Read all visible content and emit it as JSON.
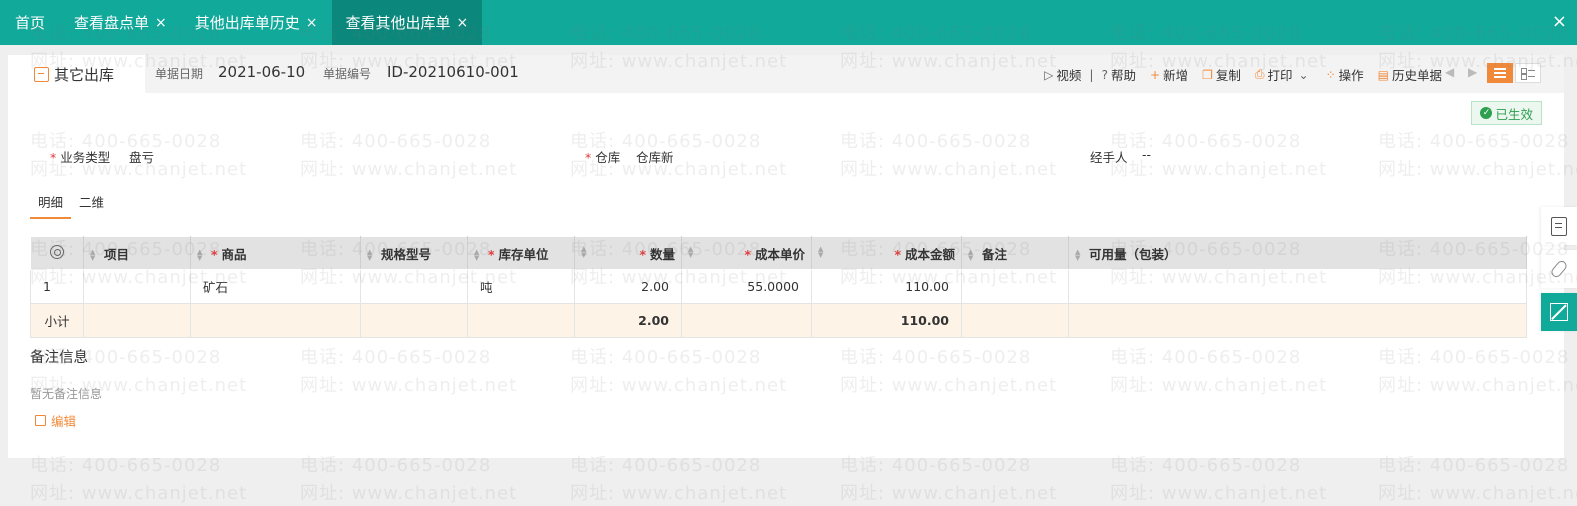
{
  "tabs": [
    {
      "label": "首页",
      "closable": false,
      "active": false
    },
    {
      "label": "查看盘点单",
      "closable": true,
      "active": false
    },
    {
      "label": "其他出库单历史",
      "closable": true,
      "active": false
    },
    {
      "label": "查看其他出库单",
      "closable": true,
      "active": true
    }
  ],
  "tab_close_glyph": "×",
  "window_close_glyph": "×",
  "doc": {
    "type_label": "其它出库",
    "date_label": "单据日期",
    "date_value": "2021-06-10",
    "number_label": "单据编号",
    "number_value": "ID-20210610-001"
  },
  "toolbar": {
    "video": "视频",
    "divider": "|",
    "help": "帮助",
    "add": "新增",
    "copy": "复制",
    "print": "打印",
    "operate": "操作",
    "history": "历史单据"
  },
  "status": {
    "label": "已生效",
    "color": "#2e9e4f"
  },
  "fields": {
    "biz_type_label": "业务类型",
    "biz_type_value": "盘亏",
    "warehouse_label": "仓库",
    "warehouse_value": "仓库新",
    "handler_label": "经手人",
    "handler_value": "--",
    "required_mark": "*"
  },
  "subtabs": [
    "明细",
    "二维"
  ],
  "grid": {
    "columns": [
      "项目",
      "商品",
      "规格型号",
      "库存单位",
      "数量",
      "成本单价",
      "成本金额",
      "备注",
      "可用量（包装）"
    ],
    "rows": [
      {
        "idx": "1",
        "project": "",
        "product": "矿石",
        "spec": "",
        "unit": "吨",
        "qty": "2.00",
        "unit_cost": "55.0000",
        "amount": "110.00",
        "note": "",
        "available": ""
      }
    ],
    "subtotal": {
      "label": "小计",
      "qty": "2.00",
      "amount": "110.00"
    }
  },
  "remark": {
    "title": "备注信息",
    "empty_text": "暂无备注信息",
    "edit_label": "编辑"
  },
  "watermark": {
    "phone": "电话: 400-665-0028",
    "site": "网址: www.chanjet.net"
  },
  "colors": {
    "primary": "#10a99a",
    "primary_dark": "#0b877b",
    "accent": "#f08a3a",
    "required": "#e23b3b",
    "subtotal_bg": "#fdf3e6"
  },
  "icons": [
    "settings-gear-icon",
    "video-play-icon",
    "help-icon",
    "plus-icon",
    "copy-icon",
    "printer-icon",
    "chevron-down-icon",
    "operations-grid-icon",
    "history-icon",
    "arrow-left-icon",
    "arrow-right-icon",
    "list-view-icon",
    "card-view-icon",
    "check-circle-icon",
    "document-icon",
    "attachment-icon",
    "expand-icon",
    "edit-icon",
    "sort-icon",
    "outbound-doc-icon"
  ]
}
